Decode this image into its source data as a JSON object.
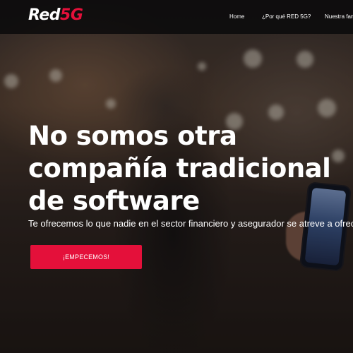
{
  "brand": {
    "logo_primary": "Red",
    "logo_accent": "5G",
    "accent_color": "#e4103a"
  },
  "nav": {
    "items": [
      {
        "label": "Home"
      },
      {
        "label": "¿Por qué RED 5G?"
      },
      {
        "label": "Nuestra fam"
      }
    ]
  },
  "hero": {
    "headline_line1": "No somos otra",
    "headline_line2": "compañía tradicional",
    "headline_line3": "de software",
    "subtitle": "Te ofrecemos lo que nadie en el sector financiero y asegurador se atreve a ofrecer",
    "cta_label": "¡EMPECEMOS!"
  }
}
